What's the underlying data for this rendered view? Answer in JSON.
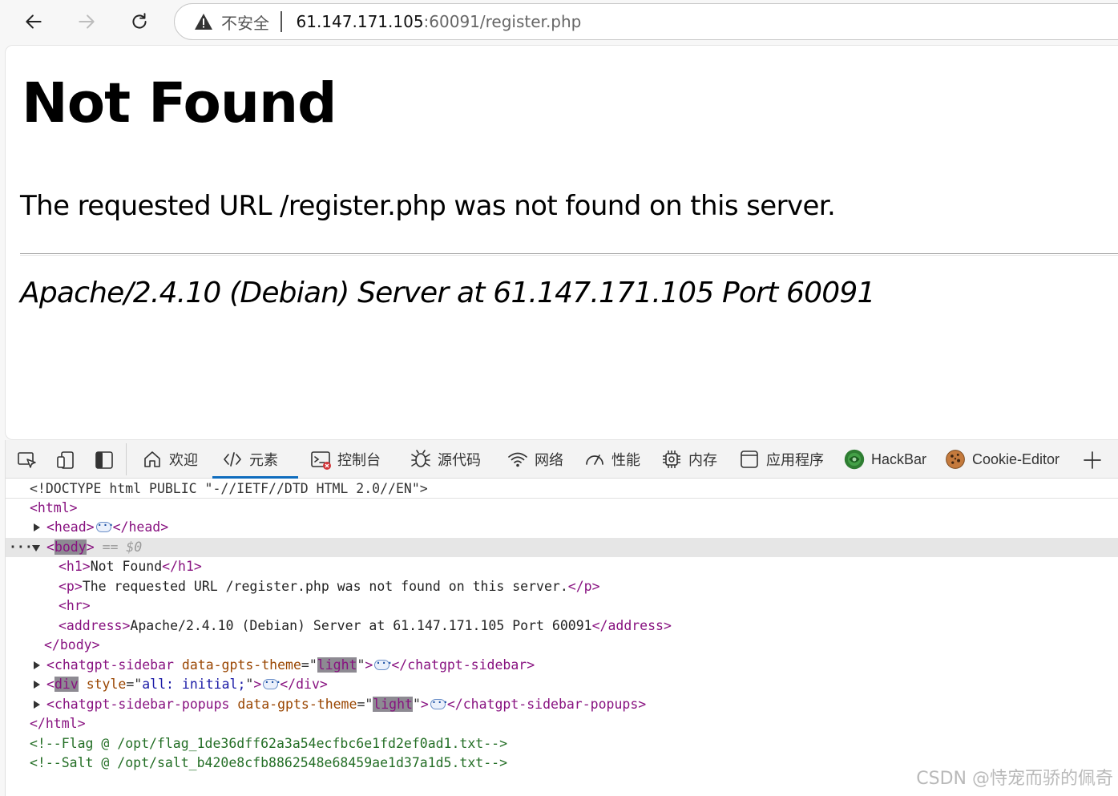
{
  "browser": {
    "security_label": "不安全",
    "url_host": "61.147.171.105",
    "url_rest": ":60091/register.php"
  },
  "page": {
    "heading": "Not Found",
    "message": "The requested URL /register.php was not found on this server.",
    "address": "Apache/2.4.10 (Debian) Server at 61.147.171.105 Port 60091"
  },
  "devtools": {
    "tabs": [
      {
        "label": "欢迎",
        "icon": "home-icon"
      },
      {
        "label": "元素",
        "icon": "code-brackets-icon"
      },
      {
        "label": "控制台",
        "icon": "console-icon"
      },
      {
        "label": "源代码",
        "icon": "bug-icon"
      },
      {
        "label": "网络",
        "icon": "wifi-icon"
      },
      {
        "label": "性能",
        "icon": "gauge-icon"
      },
      {
        "label": "内存",
        "icon": "chip-icon"
      },
      {
        "label": "应用程序",
        "icon": "app-window-icon"
      },
      {
        "label": "HackBar",
        "icon": "hackbar-logo"
      },
      {
        "label": "Cookie-Editor",
        "icon": "cookie-icon"
      }
    ],
    "active_tab": "元素",
    "dom": {
      "doctype": "<!DOCTYPE html PUBLIC \"-//IETF//DTD HTML 2.0//EN\">",
      "selected_marker": "== $0",
      "h1_text": "Not Found",
      "p_text": "The requested URL /register.php was not found on this server.",
      "address_text": "Apache/2.4.10 (Debian) Server at 61.147.171.105 Port 60091",
      "sidebar_tag": "chatgpt-sidebar",
      "popups_tag": "chatgpt-sidebar-popups",
      "theme_attr": "data-gpts-theme",
      "theme_value": "light",
      "div_style_value": "all: initial;",
      "comment_flag": "<!--Flag @ /opt/flag_1de36dff62a3a54ecfbc6e1fd2ef0ad1.txt-->",
      "comment_salt": "<!--Salt @ /opt/salt_b420e8cfb8862548e68459ae1d37a1d5.txt-->"
    }
  },
  "watermark": "CSDN @恃宠而骄的佩奇"
}
